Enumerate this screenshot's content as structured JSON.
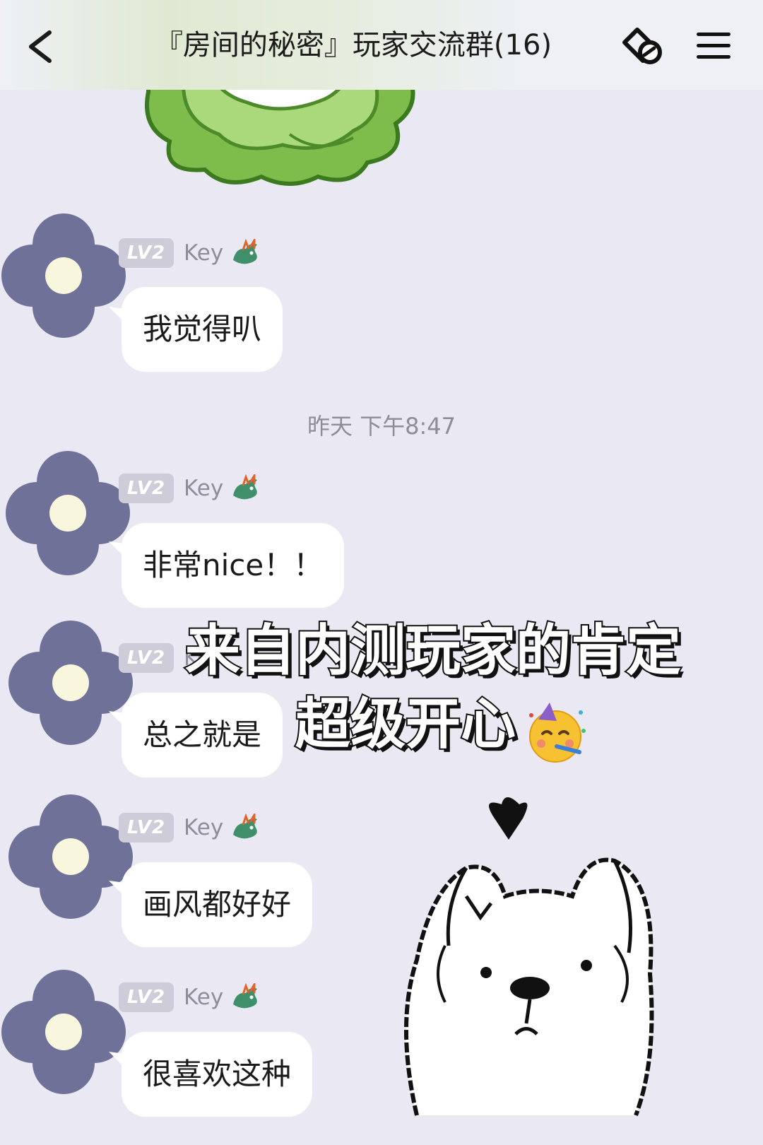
{
  "header": {
    "back_icon": "chevron-left-icon",
    "title": "『房间的秘密』玩家交流群(16)",
    "link_icon": "chain-link-icon",
    "menu_icon": "hamburger-menu-icon"
  },
  "messages": [
    {
      "sender_level": "LV2",
      "sender_name": "Key",
      "text": "我觉得叭"
    },
    {
      "sender_level": "LV2",
      "sender_name": "Key",
      "text": "非常nice！！"
    },
    {
      "sender_level": "LV2",
      "sender_name": "Key",
      "text": "总之就是"
    },
    {
      "sender_level": "LV2",
      "sender_name": "Key",
      "text": "画风都好好"
    },
    {
      "sender_level": "LV2",
      "sender_name": "Key",
      "text": "很喜欢这种"
    }
  ],
  "timestamp": "昨天 下午8:47",
  "overlay": {
    "line1": "来自内测玩家的肯定",
    "line2": "超级开心"
  },
  "colors": {
    "background": "#e9e8f3",
    "avatar_petal": "#6f7199",
    "avatar_center": "#f8f6dc",
    "level_badge": "#cdccd8",
    "bubble": "#ffffff"
  },
  "stickers": [
    "cabbage-sticker",
    "dog-sticker",
    "party-face-emoji"
  ]
}
